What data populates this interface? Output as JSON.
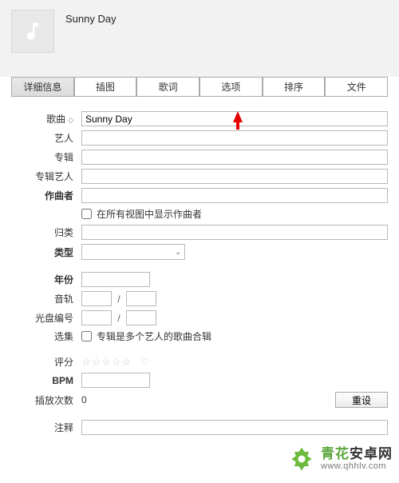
{
  "header": {
    "title": "Sunny Day"
  },
  "tabs": [
    {
      "label": "详细信息",
      "active": true
    },
    {
      "label": "插图"
    },
    {
      "label": "歌词"
    },
    {
      "label": "选项"
    },
    {
      "label": "排序"
    },
    {
      "label": "文件"
    }
  ],
  "form": {
    "song_label": "歌曲",
    "song_value": "Sunny Day",
    "artist_label": "艺人",
    "album_label": "专辑",
    "album_artist_label": "专辑艺人",
    "composer_label": "作曲者",
    "show_composer_label": "在所有视图中显示作曲者",
    "grouping_label": "归类",
    "genre_label": "类型",
    "year_label": "年份",
    "track_label": "音轨",
    "disc_label": "光盘编号",
    "track_sep": "/",
    "compilation_label": "选集",
    "compilation_check_label": "专辑是多个艺人的歌曲合辑",
    "rating_label": "评分",
    "bpm_label": "BPM",
    "play_count_label": "插放次数",
    "play_count_value": "0",
    "reset_label": "重设",
    "comments_label": "注释"
  },
  "watermark": {
    "cn_green": "青花",
    "cn_black": "安卓网",
    "url": "www.qhhlv.com"
  }
}
